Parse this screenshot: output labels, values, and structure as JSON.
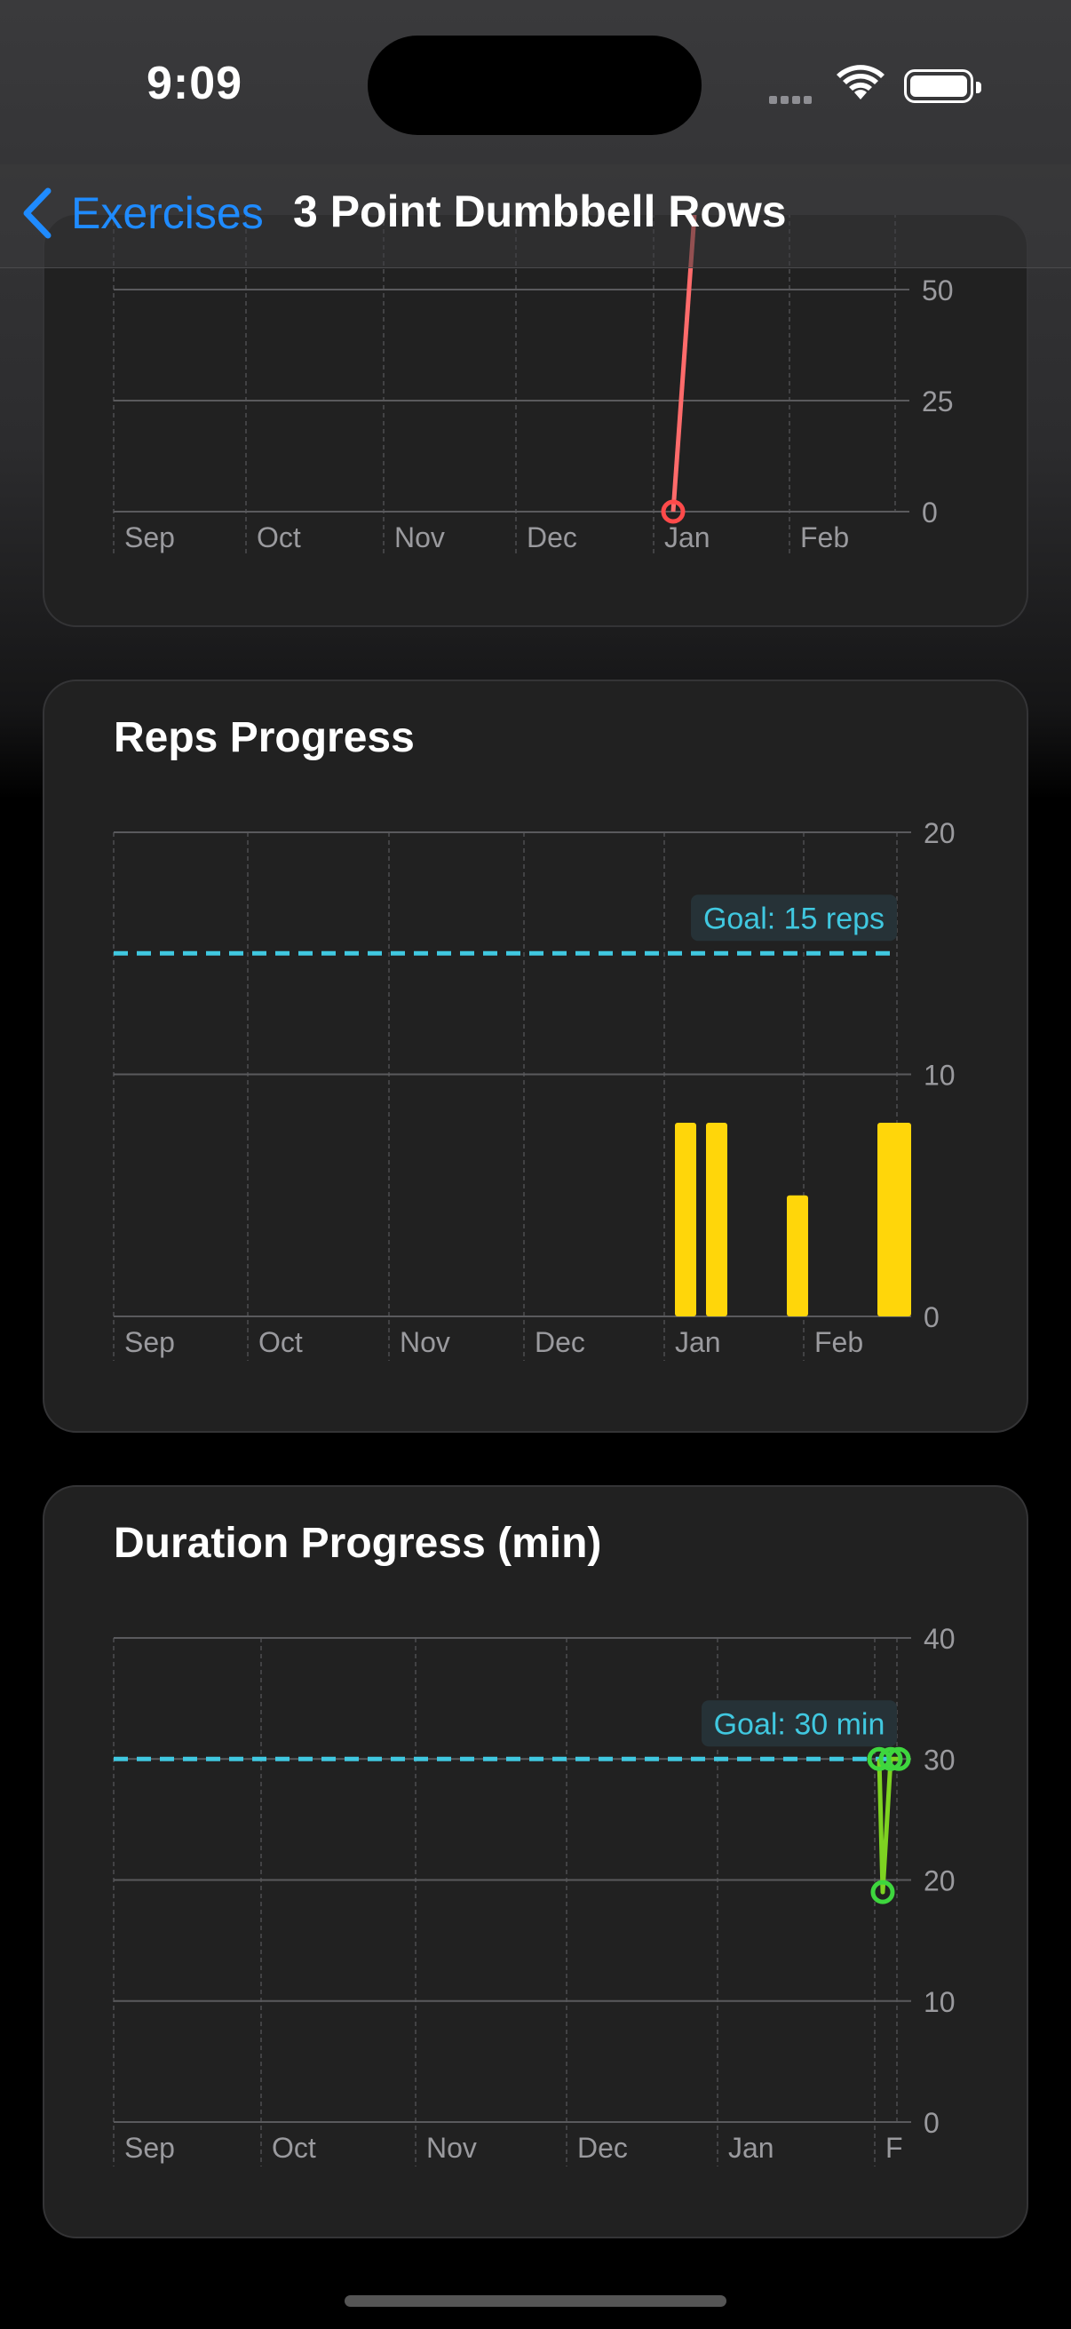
{
  "status_bar": {
    "time": "9:09"
  },
  "nav": {
    "back_label": "Exercises",
    "title": "3 Point Dumbbell Rows"
  },
  "colors": {
    "accent": "#1f8bff",
    "weight_line": "#ff6b6b",
    "reps_bar": "#ffd60a",
    "duration_line": "#6cde3a",
    "goal_line": "#40c8e0"
  },
  "chart_data": [
    {
      "type": "line",
      "title": "",
      "x_ticks": [
        "Sep",
        "Oct",
        "Nov",
        "Dec",
        "Jan",
        "Feb"
      ],
      "y_ticks": [
        0,
        25,
        50
      ],
      "ylim": [
        0,
        50
      ],
      "series": [
        {
          "points": [
            {
              "x": "Jan",
              "y": 0
            },
            {
              "x": "Jan",
              "y": 55
            }
          ]
        }
      ],
      "grid": true
    },
    {
      "type": "bar",
      "title": "Reps Progress",
      "x_ticks": [
        "Sep",
        "Oct",
        "Nov",
        "Dec",
        "Jan",
        "Feb"
      ],
      "y_ticks": [
        0,
        10,
        20
      ],
      "ylim": [
        0,
        25
      ],
      "goal_label": "Goal: 15 reps",
      "goal_value": 15,
      "values": [
        8,
        8,
        5,
        8
      ],
      "grid": true
    },
    {
      "type": "line",
      "title": "Duration Progress (min)",
      "x_ticks": [
        "Sep",
        "Oct",
        "Nov",
        "Dec",
        "Jan",
        "F"
      ],
      "y_ticks": [
        0,
        10,
        20,
        30,
        40
      ],
      "ylim": [
        0,
        40
      ],
      "goal_label": "Goal: 30 min",
      "goal_value": 30,
      "values": [
        30,
        19,
        30,
        30
      ],
      "grid": true
    }
  ]
}
